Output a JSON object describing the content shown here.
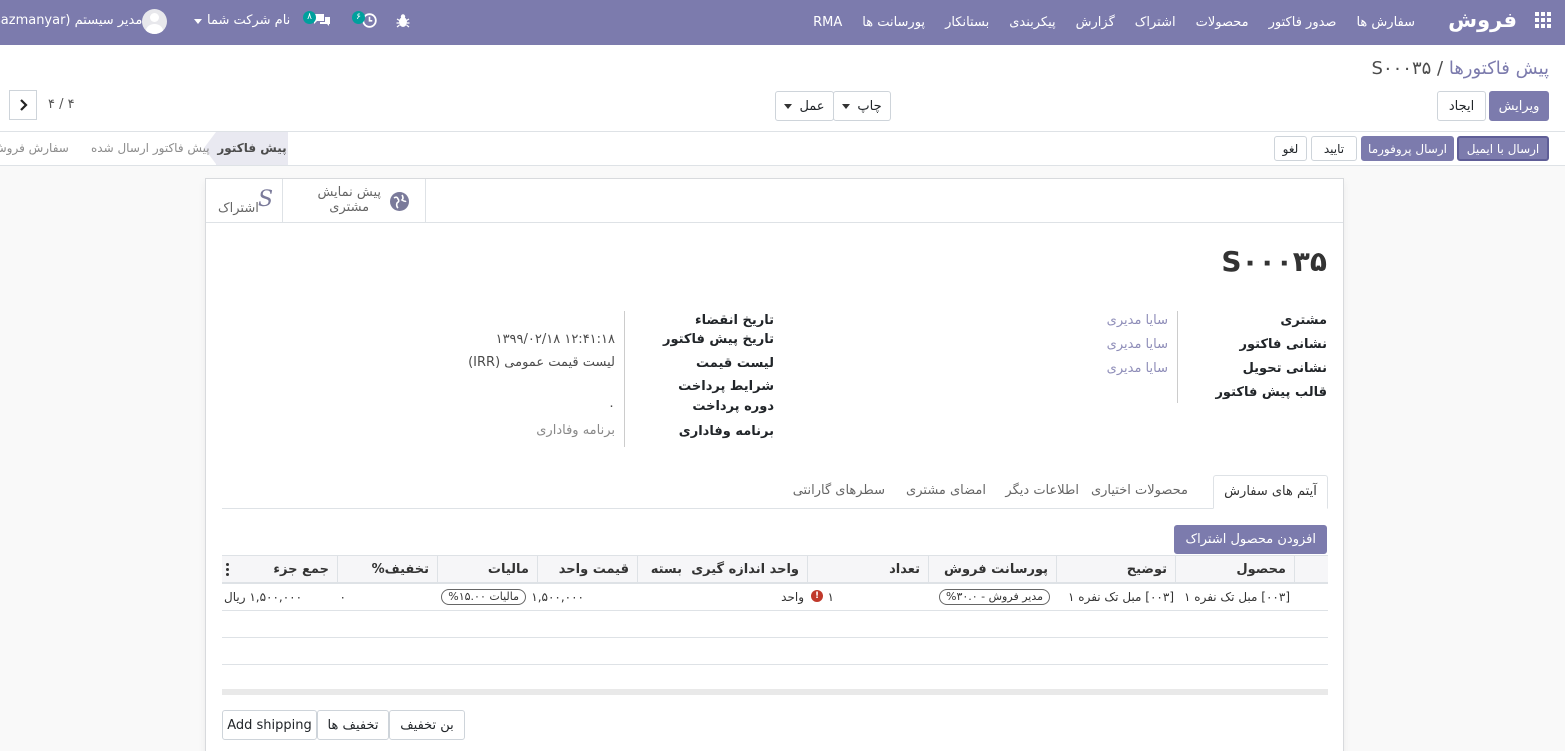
{
  "navbar": {
    "brand": "فروش",
    "menu": [
      "سفارش ها",
      "صدور فاکتور",
      "محصولات",
      "اشتراک",
      "گزارش",
      "پیکربندی",
      "بستانکار",
      "پورسانت ها",
      "RMA"
    ],
    "company": "نام شرکت شما",
    "user": "sazmanyar) مدیر سیستم",
    "chat_count": "۸",
    "activity_count": "۶"
  },
  "control": {
    "breadcrumb_parent": "پیش فاکتورها",
    "breadcrumb_sep": " / ",
    "breadcrumb_current": "S۰۰۰۳۵",
    "edit_label": "ویرایش",
    "create_label": "ایجاد",
    "print_label": "چاپ",
    "action_label": "عمل",
    "pager": "۴ / ۴"
  },
  "statusbar": {
    "send_email": "ارسال با ایمیل",
    "send_proforma": "ارسال پروفورما",
    "confirm": "تایید",
    "cancel": "لغو",
    "stages": [
      "پیش فاکتور",
      "پیش فاکتور ارسال شده",
      "سفارش فروش"
    ]
  },
  "smart_buttons": {
    "preview_line1": "پیش نمایش",
    "preview_line2": "مشتری",
    "subscription": "اشتراک"
  },
  "form": {
    "title": "S۰۰۰۳۵",
    "left_labels": {
      "customer": "مشتری",
      "invoice_address": "نشانی فاکتور",
      "delivery_address": "نشانی تحویل",
      "quote_template": "قالب پیش فاکتور"
    },
    "left_values": {
      "customer": "سایا مدیری",
      "invoice_address": "سایا مدیری",
      "delivery_address": "سایا مدیری"
    },
    "right_labels": {
      "expiration": "تاریخ انقضاء",
      "quotation_date": "تاریخ پیش فاکتور",
      "pricelist": "لیست قیمت",
      "payment_terms": "شرایط پرداخت",
      "payment_period": "دوره پرداخت",
      "loyalty": "برنامه وفاداری"
    },
    "right_values": {
      "quotation_date": "۱۳۹۹/۰۲/۱۸ ۱۲:۴۱:۱۸",
      "pricelist": "لیست قیمت عمومی (IRR)",
      "payment_period": "۰",
      "loyalty": "برنامه وفاداری"
    }
  },
  "tabs": [
    "آیتم های سفارش",
    "محصولات اختیاری",
    "اطلاعات دیگر",
    "امضای مشتری",
    "سطرهای گارانتی"
  ],
  "add_subscription_label": "افزودن محصول اشتراک",
  "table": {
    "headers": {
      "product": "محصول",
      "description": "توضیح",
      "commission": "پورسانت فروش",
      "qty": "تعداد",
      "uom": "واحد اندازه گیری",
      "package": "بسته",
      "unit_price": "قیمت واحد",
      "taxes": "مالیات",
      "discount": "تخفیف%",
      "subtotal": "جمع جزء"
    },
    "row": {
      "product": "[۰۰۳] مبل تک نفره ۱",
      "description": "[۰۰۳] مبل تک نفره ۱",
      "commission": "مدیر فروش - ۳۰.۰%",
      "qty": "۱",
      "uom": "واحد",
      "unit_price": "۱,۵۰۰,۰۰۰",
      "taxes": "مالیات ۱۵.۰۰%",
      "discount": "۰",
      "subtotal": "۱,۵۰۰,۰۰۰ ریال"
    }
  },
  "bottom_buttons": {
    "coupon": "بن تخفیف",
    "promotions": "تخفیف ها",
    "shipping": "Add shipping"
  },
  "colors": {
    "brand": "#7c7bad",
    "badge": "#00a09d",
    "warning": "#c0392b"
  }
}
